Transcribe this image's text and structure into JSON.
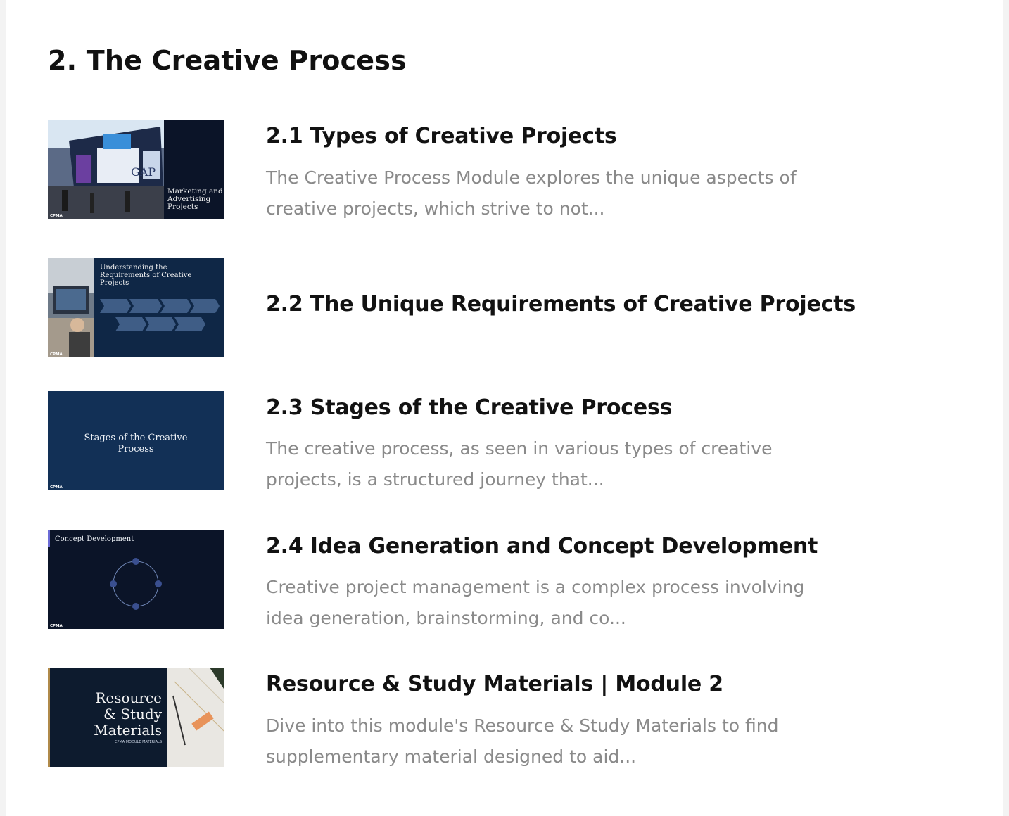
{
  "module": {
    "title": "2. The Creative Process"
  },
  "lessons": [
    {
      "title": "2.1 Types of Creative Projects",
      "description": "The Creative Process Module explores the unique aspects of creative projects, which strive to not...",
      "thumbnail": {
        "caption_lines": [
          "Marketing and",
          "Advertising",
          "Projects"
        ],
        "brand": "GAP",
        "logo": "CPMA"
      }
    },
    {
      "title": "2.2 The Unique Requirements of Creative Projects",
      "description": "",
      "thumbnail": {
        "caption_lines": [
          "Understanding the",
          "Requirements of Creative",
          "Projects"
        ],
        "logo": "CPMA"
      }
    },
    {
      "title": "2.3 Stages of the Creative Process",
      "description": "The creative process, as seen in various types of creative projects, is a structured journey that...",
      "thumbnail": {
        "caption_lines": [
          "Stages of the Creative",
          "Process"
        ],
        "logo": "CPMA"
      }
    },
    {
      "title": "2.4 Idea Generation and Concept Development",
      "description": "Creative project management is a complex process involving idea generation, brainstorming, and co...",
      "thumbnail": {
        "caption_lines": [
          "Concept Development"
        ],
        "logo": "CPMA"
      }
    },
    {
      "title": "Resource & Study Materials | Module 2",
      "description": "Dive into this module's Resource & Study Materials to find supplementary material designed to aid...",
      "thumbnail": {
        "caption_lines": [
          "Resource",
          "& Study",
          "Materials"
        ],
        "sub_caption": "CPMA MODULE MATERIALS"
      }
    }
  ],
  "colors": {
    "heading": "#121212",
    "description": "#8a8a8a",
    "slide_navy": "#0f2746",
    "slide_dark": "#0b1428"
  }
}
